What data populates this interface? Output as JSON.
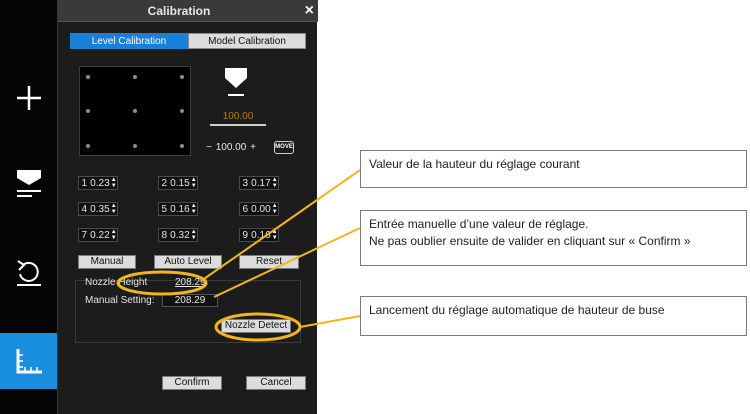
{
  "toolbar": {
    "items": [
      {
        "icon": "plus-icon"
      },
      {
        "icon": "nozzle-icon"
      },
      {
        "icon": "undo-icon"
      },
      {
        "icon": "ruler-icon",
        "active": true
      }
    ],
    "accent": "#1a8fe0"
  },
  "dialog": {
    "title": "Calibration",
    "close_label": "×",
    "tabs": [
      {
        "label": "Level Calibration",
        "active": true
      },
      {
        "label": "Model Calibration",
        "active": false
      }
    ],
    "z_readout": "100.00",
    "stepper": {
      "minus": "−",
      "value": "100.00",
      "plus": "+"
    },
    "move_label": "MOVE",
    "points": [
      {
        "num": "1",
        "value": "0.23"
      },
      {
        "num": "2",
        "value": "0.15"
      },
      {
        "num": "3",
        "value": "0.17"
      },
      {
        "num": "4",
        "value": "0.35"
      },
      {
        "num": "5",
        "value": "0.16"
      },
      {
        "num": "6",
        "value": "0.00"
      },
      {
        "num": "7",
        "value": "0.22"
      },
      {
        "num": "8",
        "value": "0.32"
      },
      {
        "num": "9",
        "value": "0.16"
      }
    ],
    "buttons": {
      "manual": "Manual",
      "auto_level": "Auto Level",
      "reset": "Reset"
    },
    "nozzle": {
      "height_label": "Nozzle Height",
      "height_value": "208.29",
      "manual_label": "Manual Setting:",
      "manual_value": "208.29",
      "detect_label": "Nozzle Detect"
    },
    "confirm_label": "Confirm",
    "cancel_label": "Cancel"
  },
  "annotations": {
    "current_height": "Valeur de la hauteur du réglage courant",
    "manual_entry_line1": "Entrée manuelle d’une valeur de réglage.",
    "manual_entry_line2": "Ne pas oublier ensuite de valider en cliquant sur « Confirm »",
    "auto_detect": "Lancement du réglage automatique de hauteur de buse",
    "highlight_color": "#f2b51c"
  }
}
